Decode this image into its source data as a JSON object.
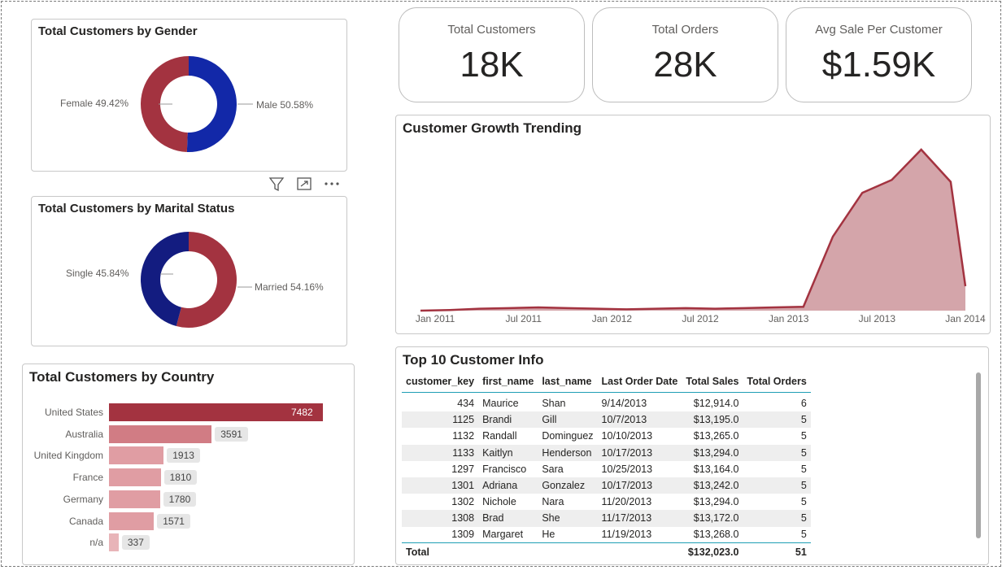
{
  "kpis": [
    {
      "label": "Total Customers",
      "value": "18K"
    },
    {
      "label": "Total Orders",
      "value": "28K"
    },
    {
      "label": "Avg Sale Per Customer",
      "value": "$1.59K"
    }
  ],
  "gender_chart": {
    "title": "Total Customers by Gender",
    "chart_data": {
      "type": "pie",
      "donut": true,
      "labels": [
        "Male",
        "Female"
      ],
      "values": [
        50.58,
        49.42
      ],
      "colors": [
        "#1228a8",
        "#a33340"
      ]
    },
    "label_male": "Male 50.58%",
    "label_female": "Female 49.42%"
  },
  "marital_chart": {
    "title": "Total Customers by Marital Status",
    "chart_data": {
      "type": "pie",
      "donut": true,
      "labels": [
        "Married",
        "Single"
      ],
      "values": [
        54.16,
        45.84
      ],
      "colors": [
        "#a33340",
        "#131c80"
      ]
    },
    "label_married": "Married 54.16%",
    "label_single": "Single 45.84%"
  },
  "visual_header": {
    "icons": [
      "filter-icon",
      "focus-mode-icon",
      "more-options-icon"
    ]
  },
  "country_chart": {
    "title": "Total Customers by Country",
    "chart_data": {
      "type": "bar",
      "orientation": "horizontal",
      "categories": [
        "United States",
        "Australia",
        "United Kingdom",
        "France",
        "Germany",
        "Canada",
        "n/a"
      ],
      "values": [
        7482,
        3591,
        1913,
        1810,
        1780,
        1571,
        337
      ],
      "colors": [
        "#a33340",
        "#d17c84",
        "#e09da3",
        "#e09da3",
        "#e09da3",
        "#e09da3",
        "#e8b4b8"
      ]
    }
  },
  "growth_chart": {
    "title": "Customer Growth Trending",
    "chart_data": {
      "type": "area",
      "x_ticks": [
        "Jan 2011",
        "Jul 2011",
        "Jan 2012",
        "Jul 2012",
        "Jan 2013",
        "Jul 2013",
        "Jan 2014"
      ],
      "x": [
        "2010-12",
        "2011-02",
        "2011-04",
        "2011-06",
        "2011-08",
        "2011-10",
        "2011-12",
        "2012-02",
        "2012-04",
        "2012-06",
        "2012-08",
        "2012-10",
        "2012-12",
        "2013-02",
        "2013-04",
        "2013-06",
        "2013-08",
        "2013-10",
        "2013-12",
        "2014-01"
      ],
      "values": [
        0,
        1,
        3,
        4,
        5,
        4,
        3,
        2,
        3,
        4,
        3,
        4,
        5,
        6,
        115,
        183,
        203,
        250,
        200,
        38
      ],
      "line_color": "#a33340",
      "fill_color": "#d4a5aa",
      "grid": false
    }
  },
  "top_customers": {
    "title": "Top 10 Customer Info",
    "columns": [
      "customer_key",
      "first_name",
      "last_name",
      "Last Order Date",
      "Total Sales",
      "Total Orders"
    ],
    "rows": [
      [
        "434",
        "Maurice",
        "Shan",
        "9/14/2013",
        "$12,914.0",
        "6"
      ],
      [
        "1125",
        "Brandi",
        "Gill",
        "10/7/2013",
        "$13,195.0",
        "5"
      ],
      [
        "1132",
        "Randall",
        "Dominguez",
        "10/10/2013",
        "$13,265.0",
        "5"
      ],
      [
        "1133",
        "Kaitlyn",
        "Henderson",
        "10/17/2013",
        "$13,294.0",
        "5"
      ],
      [
        "1297",
        "Francisco",
        "Sara",
        "10/25/2013",
        "$13,164.0",
        "5"
      ],
      [
        "1301",
        "Adriana",
        "Gonzalez",
        "10/17/2013",
        "$13,242.0",
        "5"
      ],
      [
        "1302",
        "Nichole",
        "Nara",
        "11/20/2013",
        "$13,294.0",
        "5"
      ],
      [
        "1308",
        "Brad",
        "She",
        "11/17/2013",
        "$13,172.0",
        "5"
      ],
      [
        "1309",
        "Margaret",
        "He",
        "11/19/2013",
        "$13,268.0",
        "5"
      ]
    ],
    "total": {
      "label": "Total",
      "sales": "$132,023.0",
      "orders": "51"
    }
  }
}
